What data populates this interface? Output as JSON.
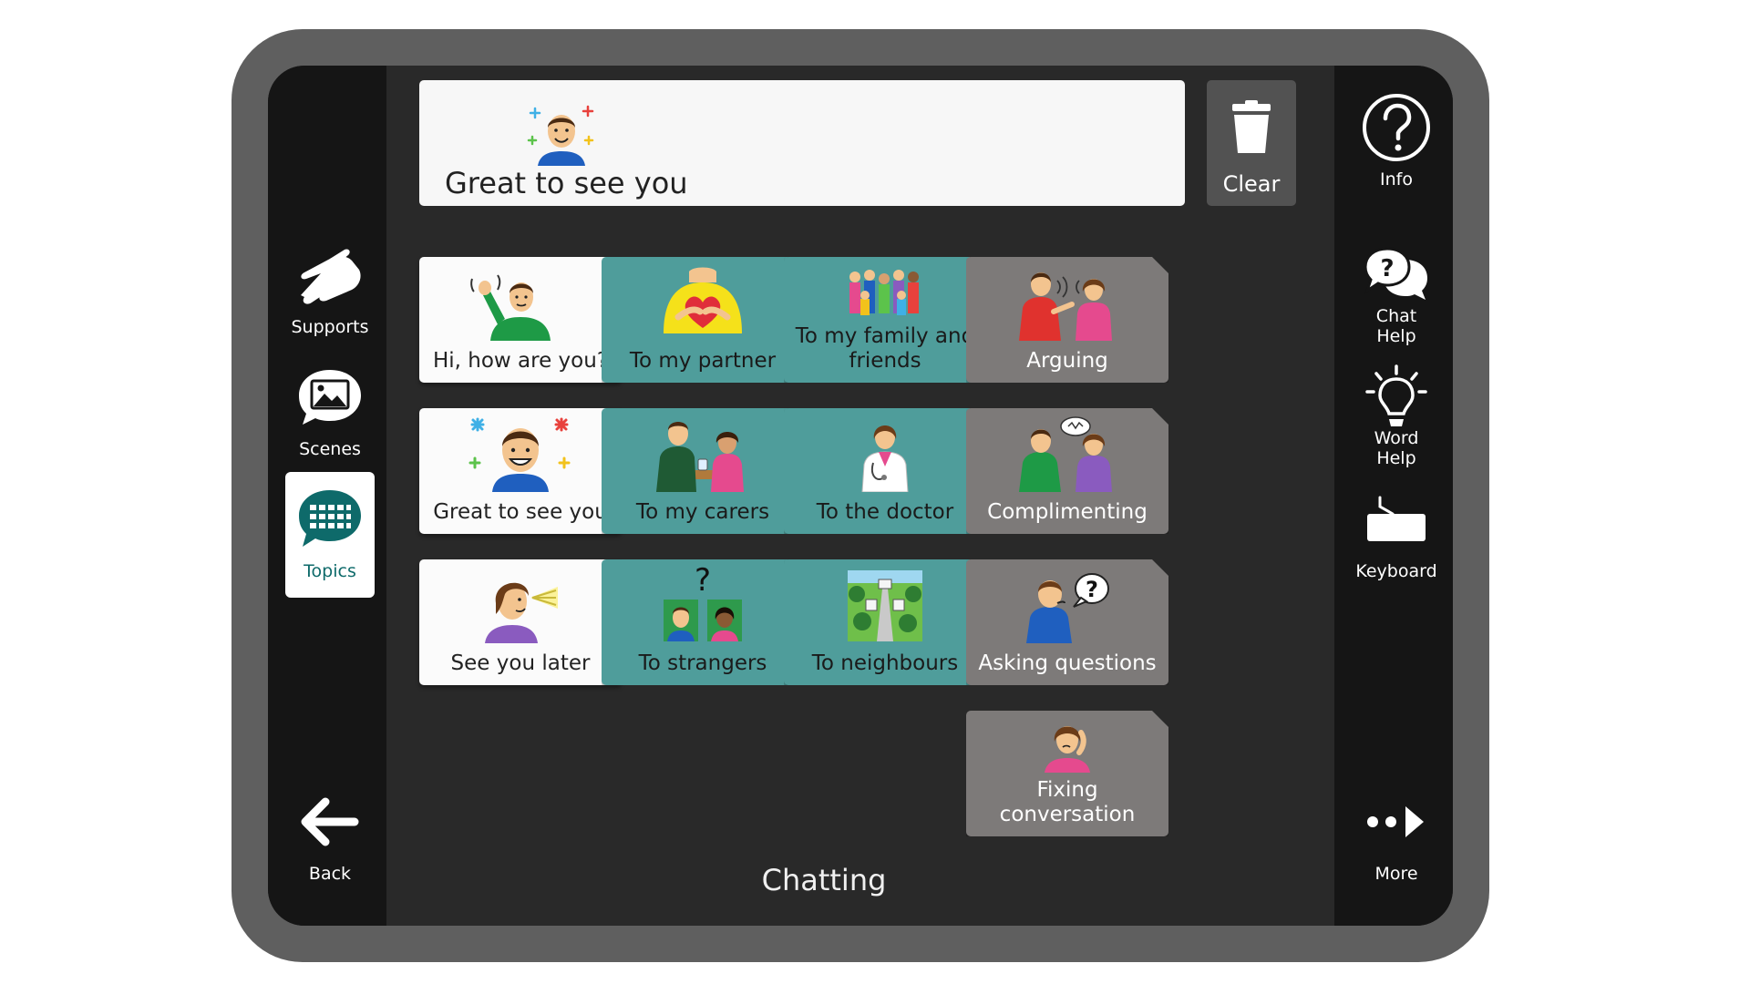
{
  "message_bar": {
    "text": "Great to see you"
  },
  "clear_button": {
    "label": "Clear"
  },
  "left_sidebar": {
    "supports": "Supports",
    "scenes": "Scenes",
    "topics": "Topics",
    "back": "Back"
  },
  "right_sidebar": {
    "info": "Info",
    "chat_help": [
      "Chat",
      "Help"
    ],
    "word_help": [
      "Word",
      "Help"
    ],
    "keyboard": "Keyboard",
    "more": "More"
  },
  "tiles": {
    "hi_how_are_you": "Hi, how are you?",
    "great_to_see_you": "Great to see you",
    "see_you_later": "See you later",
    "to_my_partner": "To my partner",
    "to_my_carers": "To my carers",
    "to_strangers": "To strangers",
    "to_my_family_and_friends": [
      "To my family and",
      "friends"
    ],
    "to_the_doctor": "To the doctor",
    "to_neighbours": "To neighbours",
    "arguing": "Arguing",
    "complimenting": "Complimenting",
    "asking_questions": "Asking questions",
    "fixing_conversation": [
      "Fixing",
      "conversation"
    ]
  },
  "page_title": "Chatting",
  "colors": {
    "teal_tile": "#4f9d9b",
    "gray_tile": "#7d7a79",
    "accent": "#0e6a6a",
    "sidebar": "#151515",
    "screen": "#292929"
  }
}
